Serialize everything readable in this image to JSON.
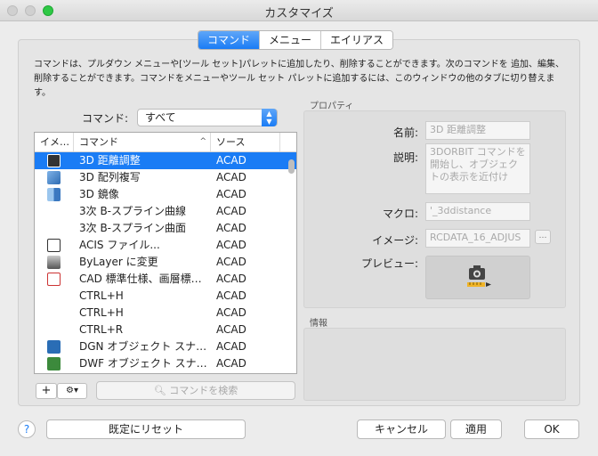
{
  "window": {
    "title": "カスタマイズ"
  },
  "tabs": [
    {
      "label": "コマンド",
      "active": true
    },
    {
      "label": "メニュー",
      "active": false
    },
    {
      "label": "エイリアス",
      "active": false
    }
  ],
  "description": "コマンドは、プルダウン メニューや[ツール セット]パレットに追加したり、削除することができます。次のコマンドを 追加、編集、削除することができます。コマンドをメニューやツール セット パレットに追加するには、このウィンドウの他のタブに切り替えます。",
  "filter": {
    "label": "コマンド:",
    "value": "すべて"
  },
  "list": {
    "headers": {
      "icon": "イメ…",
      "command": "コマンド",
      "source": "ソース"
    },
    "rows": [
      {
        "icon": "camera-measure-icon",
        "name": "3D 距離調整",
        "source": "ACAD",
        "selected": true
      },
      {
        "icon": "3d-array-icon",
        "name": "3D 配列複写",
        "source": "ACAD",
        "selected": false
      },
      {
        "icon": "3d-mirror-icon",
        "name": "3D 鏡像",
        "source": "ACAD",
        "selected": false
      },
      {
        "icon": "",
        "name": "3次 B-スプライン曲線",
        "source": "ACAD",
        "selected": false
      },
      {
        "icon": "",
        "name": "3次 B-スプライン曲面",
        "source": "ACAD",
        "selected": false
      },
      {
        "icon": "acis-file-icon",
        "name": "ACIS ファイル...",
        "source": "ACAD",
        "selected": false
      },
      {
        "icon": "bylayer-icon",
        "name": "ByLayer に変更",
        "source": "ACAD",
        "selected": false
      },
      {
        "icon": "cad-standards-icon",
        "name": "CAD 標準仕様、画層標…",
        "source": "ACAD",
        "selected": false
      },
      {
        "icon": "",
        "name": "CTRL+H",
        "source": "ACAD",
        "selected": false
      },
      {
        "icon": "",
        "name": "CTRL+H",
        "source": "ACAD",
        "selected": false
      },
      {
        "icon": "",
        "name": "CTRL+R",
        "source": "ACAD",
        "selected": false
      },
      {
        "icon": "dgn-icon",
        "name": "DGN オブジェクト スナ…",
        "source": "ACAD",
        "selected": false
      },
      {
        "icon": "dwf-icon",
        "name": "DWF オブジェクト スナ…",
        "source": "ACAD",
        "selected": false
      }
    ]
  },
  "search": {
    "placeholder": "コマンドを検索"
  },
  "properties": {
    "group_label": "プロパティ",
    "name_label": "名前:",
    "name_value": "3D 距離調整",
    "desc_label": "説明:",
    "desc_value": "3DORBIT コマンドを開始し、オブジェクトの表示を近付け",
    "macro_label": "マクロ:",
    "macro_value": "'_3ddistance",
    "image_label": "イメージ:",
    "image_value": "RCDATA_16_ADJUS",
    "image_button": "…",
    "preview_label": "プレビュー:"
  },
  "info": {
    "group_label": "情報"
  },
  "footer": {
    "help": "?",
    "reset": "既定にリセット",
    "cancel": "キャンセル",
    "apply": "適用",
    "ok": "OK"
  },
  "colors": {
    "accent": "#1a7cf5",
    "zoom": "#2ec845"
  }
}
